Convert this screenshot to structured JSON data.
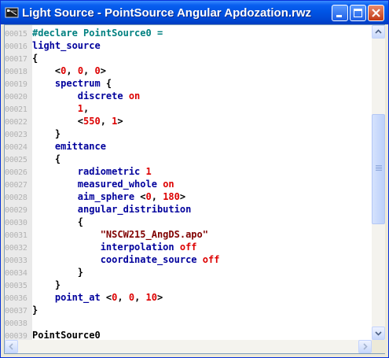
{
  "window": {
    "title": "Light Source - PointSource Angular Apdozation.rwz",
    "controls": {
      "minimize_icon": "minimize-icon",
      "maximize_icon": "maximize-icon",
      "close_icon": "close-icon"
    }
  },
  "colors": {
    "titlebar": "#0055e5",
    "keyword": "#00009c",
    "directive": "#008080",
    "value": "#dd0000",
    "string": "#800000",
    "line_number": "#b2b2b2",
    "gutter": "#eaeaea"
  },
  "editor": {
    "lines": [
      {
        "number": "00015",
        "tokens": [
          {
            "t": "#declare PointSource0 =",
            "c": "dir"
          }
        ]
      },
      {
        "number": "00016",
        "tokens": [
          {
            "t": "light_source",
            "c": "kw"
          }
        ]
      },
      {
        "number": "00017",
        "tokens": [
          {
            "t": "{",
            "c": "sym"
          }
        ]
      },
      {
        "number": "00018",
        "tokens": [
          {
            "t": "    <",
            "c": "sym"
          },
          {
            "t": "0",
            "c": "val"
          },
          {
            "t": ", ",
            "c": "sym"
          },
          {
            "t": "0",
            "c": "val"
          },
          {
            "t": ", ",
            "c": "sym"
          },
          {
            "t": "0",
            "c": "val"
          },
          {
            "t": ">",
            "c": "sym"
          }
        ]
      },
      {
        "number": "00019",
        "tokens": [
          {
            "t": "    spectrum",
            "c": "kw"
          },
          {
            "t": " {",
            "c": "sym"
          }
        ]
      },
      {
        "number": "00020",
        "tokens": [
          {
            "t": "        discrete",
            "c": "kw"
          },
          {
            "t": " ",
            "c": "sym"
          },
          {
            "t": "on",
            "c": "val"
          }
        ]
      },
      {
        "number": "00021",
        "tokens": [
          {
            "t": "        ",
            "c": "sym"
          },
          {
            "t": "1",
            "c": "val"
          },
          {
            "t": ",",
            "c": "sym"
          }
        ]
      },
      {
        "number": "00022",
        "tokens": [
          {
            "t": "        <",
            "c": "sym"
          },
          {
            "t": "550",
            "c": "val"
          },
          {
            "t": ", ",
            "c": "sym"
          },
          {
            "t": "1",
            "c": "val"
          },
          {
            "t": ">",
            "c": "sym"
          }
        ]
      },
      {
        "number": "00023",
        "tokens": [
          {
            "t": "    }",
            "c": "sym"
          }
        ]
      },
      {
        "number": "00024",
        "tokens": [
          {
            "t": "    emittance",
            "c": "kw"
          }
        ]
      },
      {
        "number": "00025",
        "tokens": [
          {
            "t": "    {",
            "c": "sym"
          }
        ]
      },
      {
        "number": "00026",
        "tokens": [
          {
            "t": "        radiometric",
            "c": "kw"
          },
          {
            "t": " ",
            "c": "sym"
          },
          {
            "t": "1",
            "c": "val"
          }
        ]
      },
      {
        "number": "00027",
        "tokens": [
          {
            "t": "        measured_whole",
            "c": "kw"
          },
          {
            "t": " ",
            "c": "sym"
          },
          {
            "t": "on",
            "c": "val"
          }
        ]
      },
      {
        "number": "00028",
        "tokens": [
          {
            "t": "        aim_sphere",
            "c": "kw"
          },
          {
            "t": " <",
            "c": "sym"
          },
          {
            "t": "0",
            "c": "val"
          },
          {
            "t": ", ",
            "c": "sym"
          },
          {
            "t": "180",
            "c": "val"
          },
          {
            "t": ">",
            "c": "sym"
          }
        ]
      },
      {
        "number": "00029",
        "tokens": [
          {
            "t": "        angular_distribution",
            "c": "kw"
          }
        ]
      },
      {
        "number": "00030",
        "tokens": [
          {
            "t": "        {",
            "c": "sym"
          }
        ]
      },
      {
        "number": "00031",
        "tokens": [
          {
            "t": "            ",
            "c": "sym"
          },
          {
            "t": "\"NSCW215_AngDS.apo\"",
            "c": "str"
          }
        ]
      },
      {
        "number": "00032",
        "tokens": [
          {
            "t": "            interpolation",
            "c": "kw"
          },
          {
            "t": " ",
            "c": "sym"
          },
          {
            "t": "off",
            "c": "val"
          }
        ]
      },
      {
        "number": "00033",
        "tokens": [
          {
            "t": "            coordinate_source",
            "c": "kw"
          },
          {
            "t": " ",
            "c": "sym"
          },
          {
            "t": "off",
            "c": "val"
          }
        ]
      },
      {
        "number": "00034",
        "tokens": [
          {
            "t": "        }",
            "c": "sym"
          }
        ]
      },
      {
        "number": "00035",
        "tokens": [
          {
            "t": "    }",
            "c": "sym"
          }
        ]
      },
      {
        "number": "00036",
        "tokens": [
          {
            "t": "    point_at",
            "c": "kw"
          },
          {
            "t": " <",
            "c": "sym"
          },
          {
            "t": "0",
            "c": "val"
          },
          {
            "t": ", ",
            "c": "sym"
          },
          {
            "t": "0",
            "c": "val"
          },
          {
            "t": ", ",
            "c": "sym"
          },
          {
            "t": "10",
            "c": "val"
          },
          {
            "t": ">",
            "c": "sym"
          }
        ]
      },
      {
        "number": "00037",
        "tokens": [
          {
            "t": "}",
            "c": "sym"
          }
        ]
      },
      {
        "number": "00038",
        "tokens": []
      },
      {
        "number": "00039",
        "tokens": [
          {
            "t": "PointSource0",
            "c": "id"
          }
        ]
      }
    ]
  },
  "scrollbars": {
    "vertical_position": 0.43,
    "icons": [
      "scroll-up-arrow-icon",
      "scroll-down-arrow-icon",
      "scroll-left-arrow-icon",
      "scroll-right-arrow-icon"
    ]
  }
}
